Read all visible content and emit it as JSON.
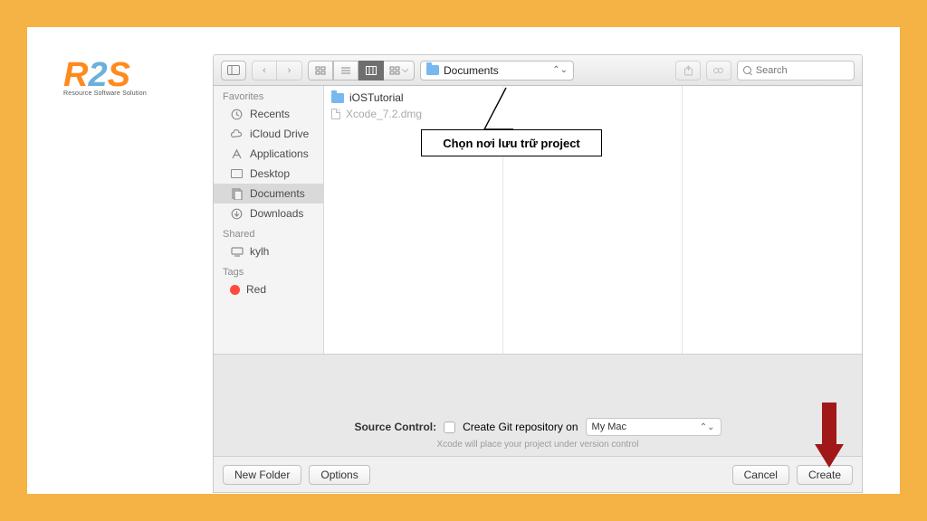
{
  "logo": {
    "tagline": "Resource Software Solution"
  },
  "toolbar": {
    "path_label": "Documents",
    "search_placeholder": "Search"
  },
  "sidebar": {
    "favorites_header": "Favorites",
    "items": [
      {
        "label": "Recents"
      },
      {
        "label": "iCloud Drive"
      },
      {
        "label": "Applications"
      },
      {
        "label": "Desktop"
      },
      {
        "label": "Documents"
      },
      {
        "label": "Downloads"
      }
    ],
    "shared_header": "Shared",
    "shared": [
      {
        "label": "kylh"
      }
    ],
    "tags_header": "Tags",
    "tags": [
      {
        "label": "Red"
      }
    ]
  },
  "filelist": {
    "items": [
      {
        "name": "iOSTutorial",
        "type": "folder"
      },
      {
        "name": "Xcode_7.2.dmg",
        "type": "file"
      }
    ]
  },
  "callout": {
    "text": "Chọn nơi lưu trữ project"
  },
  "source_control": {
    "label": "Source Control:",
    "checkbox_label": "Create Git repository on",
    "dropdown_value": "My Mac",
    "hint": "Xcode will place your project under version control"
  },
  "buttons": {
    "new_folder": "New Folder",
    "options": "Options",
    "cancel": "Cancel",
    "create": "Create"
  }
}
